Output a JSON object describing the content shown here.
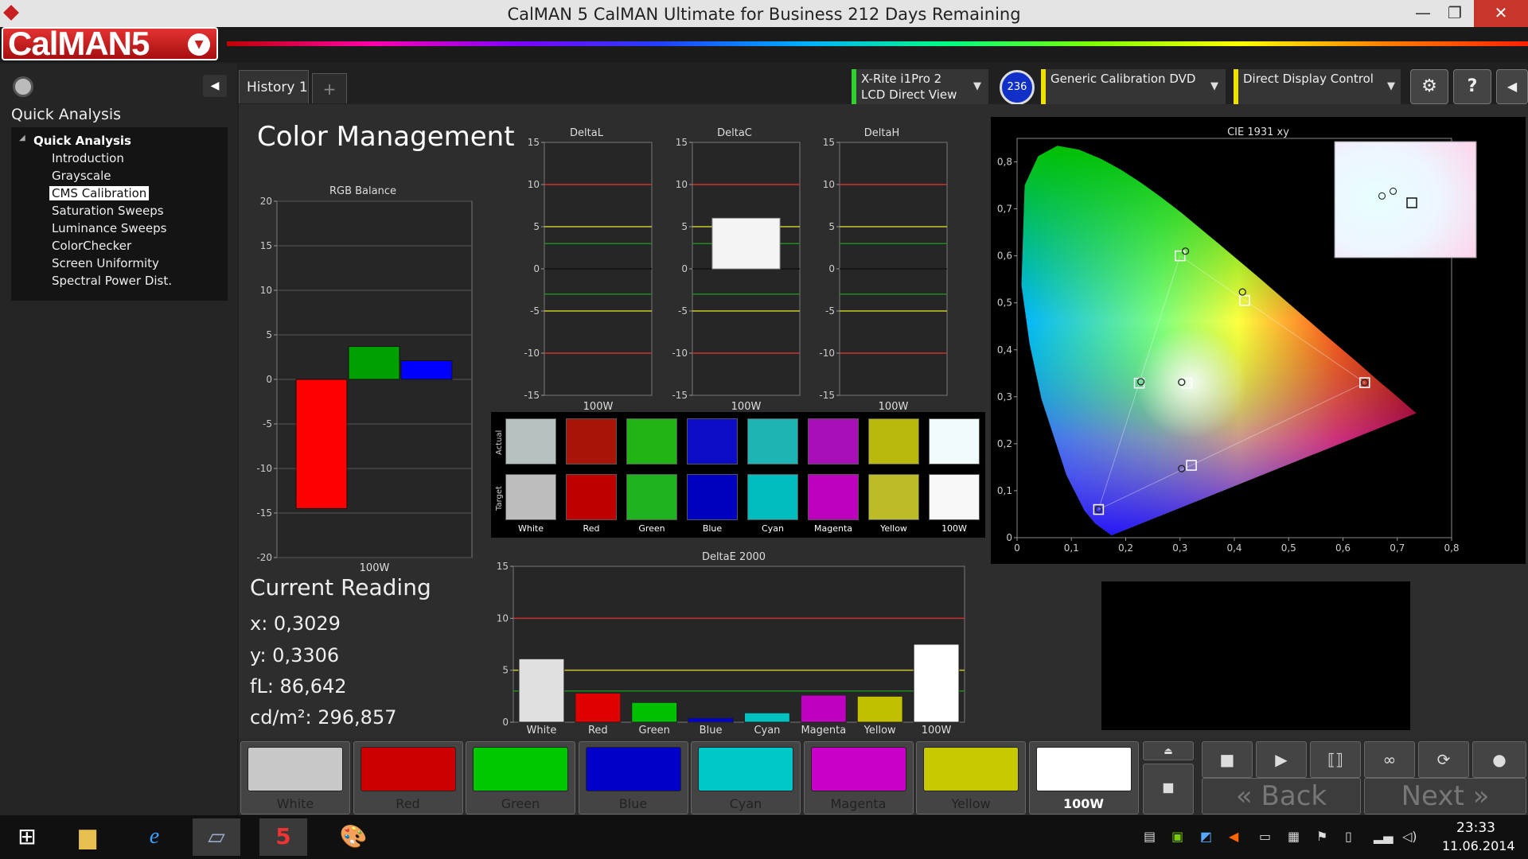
{
  "window": {
    "title": "CalMAN 5 CalMAN Ultimate for Business 212 Days Remaining",
    "minimize": "—",
    "restore": "❐",
    "close": "✕"
  },
  "app": {
    "logo": "CalMAN5"
  },
  "sidebar": {
    "title": "Quick Analysis",
    "root": "Quick Analysis",
    "items": [
      "Introduction",
      "Grayscale",
      "CMS Calibration",
      "Saturation Sweeps",
      "Luminance Sweeps",
      "ColorChecker",
      "Screen Uniformity",
      "Spectral Power Dist."
    ],
    "selected_index": 2
  },
  "tabs": {
    "history": "History 1",
    "add": "+"
  },
  "devices": {
    "meter_line1": "X-Rite i1Pro 2",
    "meter_line2": "LCD Direct View",
    "meter_badge": "236",
    "source": "Generic Calibration DVD",
    "display": "Direct Display Control"
  },
  "page": {
    "title": "Color Management"
  },
  "reading": {
    "title": "Current Reading",
    "x": "x: 0,3029",
    "y": "y: 0,3306",
    "fl": "fL: 86,642",
    "cd": "cd/m²: 296,857"
  },
  "patches": [
    {
      "name": "White",
      "color": "#c8c8c8"
    },
    {
      "name": "Red",
      "color": "#cc0000"
    },
    {
      "name": "Green",
      "color": "#00c800"
    },
    {
      "name": "Blue",
      "color": "#0000c8"
    },
    {
      "name": "Cyan",
      "color": "#00c8c8"
    },
    {
      "name": "Magenta",
      "color": "#c800c8"
    },
    {
      "name": "Yellow",
      "color": "#c8c800"
    },
    {
      "name": "100W",
      "color": "#ffffff"
    }
  ],
  "selected_patch": "100W",
  "nav": {
    "back": "Back",
    "next": "Next"
  },
  "swatches": {
    "actual_label": "Actual",
    "target_label": "Target",
    "actual": [
      "#b7c2c0",
      "#a81407",
      "#22b414",
      "#0c0cc4",
      "#1fb4b4",
      "#a90fb8",
      "#b9b80c",
      "#f2fbfb"
    ],
    "target": [
      "#bdbdbd",
      "#bf0000",
      "#1fb41f",
      "#0000bf",
      "#00bcbc",
      "#bc00bc",
      "#bcbc28",
      "#f8f8f8"
    ],
    "labels": [
      "White",
      "Red",
      "Green",
      "Blue",
      "Cyan",
      "Magenta",
      "Yellow",
      "100W"
    ]
  },
  "chart_data": [
    {
      "type": "bar",
      "title": "RGB Balance",
      "categories": [
        "100W"
      ],
      "series": [
        {
          "name": "R",
          "values": [
            -14.5
          ],
          "color": "#ff0000"
        },
        {
          "name": "G",
          "values": [
            3.7
          ],
          "color": "#00a000"
        },
        {
          "name": "B",
          "values": [
            2.1
          ],
          "color": "#0000ff"
        }
      ],
      "ylim": [
        -20,
        20
      ],
      "yticks": [
        20,
        15,
        10,
        5,
        0,
        -5,
        -10,
        -15,
        -20
      ]
    },
    {
      "type": "bar",
      "title": "DeltaL",
      "categories": [
        "100W"
      ],
      "values": [
        0.0
      ],
      "ylim": [
        -15,
        15
      ],
      "yticks": [
        15,
        10,
        5,
        0,
        -5,
        -10,
        -15
      ]
    },
    {
      "type": "bar",
      "title": "DeltaC",
      "categories": [
        "100W"
      ],
      "values": [
        6.0
      ],
      "ylim": [
        -15,
        15
      ],
      "yticks": [
        15,
        10,
        5,
        0,
        -5,
        -10,
        -15
      ]
    },
    {
      "type": "bar",
      "title": "DeltaH",
      "categories": [
        "100W"
      ],
      "values": [
        0.0
      ],
      "ylim": [
        -15,
        15
      ],
      "yticks": [
        15,
        10,
        5,
        0,
        -5,
        -10,
        -15
      ]
    },
    {
      "type": "bar",
      "title": "DeltaE 2000",
      "categories": [
        "White",
        "Red",
        "Green",
        "Blue",
        "Cyan",
        "Magenta",
        "Yellow",
        "100W"
      ],
      "values": [
        6.1,
        2.8,
        1.9,
        0.4,
        0.9,
        2.6,
        2.5,
        7.5
      ],
      "colors": [
        "#e0e0e0",
        "#e00000",
        "#00c000",
        "#0000d0",
        "#00c0c0",
        "#c000c0",
        "#c0c000",
        "#ffffff"
      ],
      "ylim": [
        0,
        15
      ],
      "yticks": [
        15,
        10,
        5,
        0
      ]
    },
    {
      "type": "scatter",
      "title": "CIE 1931 xy",
      "xlim": [
        0,
        0.8
      ],
      "ylim": [
        0,
        0.85
      ],
      "xticks": [
        "0",
        "0,1",
        "0,2",
        "0,3",
        "0,4",
        "0,5",
        "0,6",
        "0,7",
        "0,8"
      ],
      "yticks": [
        "0",
        "0,1",
        "0,2",
        "0,3",
        "0,4",
        "0,5",
        "0,6",
        "0,7",
        "0,8"
      ],
      "targets": [
        [
          0.64,
          0.33
        ],
        [
          0.3,
          0.6
        ],
        [
          0.15,
          0.06
        ],
        [
          0.3127,
          0.329
        ],
        [
          0.225,
          0.329
        ],
        [
          0.321,
          0.154
        ],
        [
          0.419,
          0.505
        ]
      ],
      "actual": [
        [
          0.64,
          0.33
        ],
        [
          0.31,
          0.61
        ],
        [
          0.15,
          0.06
        ],
        [
          0.303,
          0.331
        ],
        [
          0.228,
          0.332
        ],
        [
          0.303,
          0.147
        ],
        [
          0.415,
          0.523
        ]
      ]
    }
  ]
}
